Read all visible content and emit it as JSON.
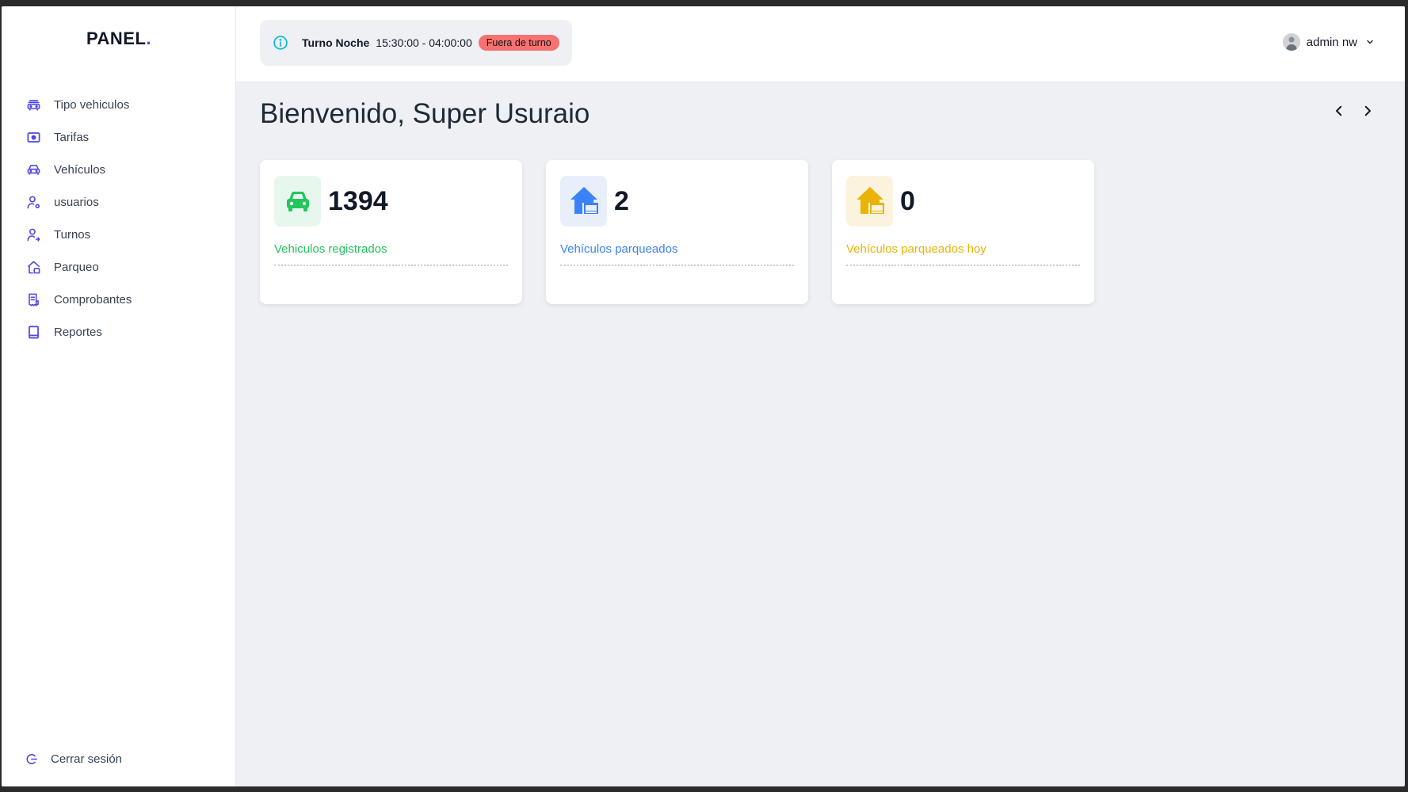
{
  "brand": {
    "name": "PANEL",
    "dot": "."
  },
  "sidebar": {
    "items": [
      {
        "label": "Tipo vehiculos",
        "icon": "vehicle-types-icon"
      },
      {
        "label": "Tarifas",
        "icon": "tariff-icon"
      },
      {
        "label": "Vehículos",
        "icon": "car-icon"
      },
      {
        "label": "usuarios",
        "icon": "user-settings-icon"
      },
      {
        "label": "Turnos",
        "icon": "user-shift-icon"
      },
      {
        "label": "Parqueo",
        "icon": "parking-home-icon"
      },
      {
        "label": "Comprobantes",
        "icon": "receipt-icon"
      },
      {
        "label": "Reportes",
        "icon": "report-icon"
      }
    ],
    "logout_label": "Cerrar sesión"
  },
  "header": {
    "shift_name": "Turno Noche",
    "shift_time": "15:30:00 - 04:00:00",
    "shift_status": "Fuera de turno",
    "user_name": "admin nw"
  },
  "main": {
    "title": "Bienvenido, Super Usuraio"
  },
  "cards": [
    {
      "value": "1394",
      "label": "Vehiculos registrados",
      "icon": "car-icon",
      "accent": "#22c55e",
      "bg": "#e8f7ee"
    },
    {
      "value": "2",
      "label": "Vehículos parqueados",
      "icon": "garage-icon",
      "accent": "#3b82f6",
      "bg": "#e8effb"
    },
    {
      "value": "0",
      "label": "Vehículos parqueados hoy",
      "icon": "garage-today-icon",
      "accent": "#eab308",
      "bg": "#fbf3de"
    }
  ],
  "colors": {
    "nav_icon": "#4f46e5",
    "info_icon": "#06b6d4",
    "badge": "#f87171"
  }
}
